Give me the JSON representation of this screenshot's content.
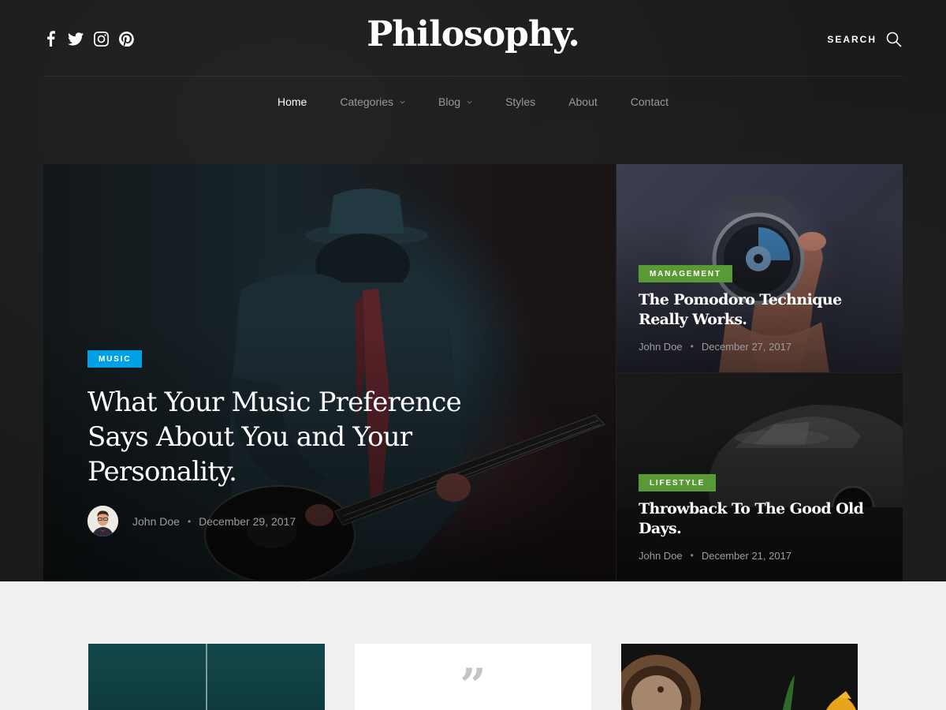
{
  "header": {
    "logo": "Philosophy.",
    "search_label": "SEARCH",
    "social": [
      "facebook-icon",
      "twitter-icon",
      "instagram-icon",
      "pinterest-icon"
    ]
  },
  "nav": {
    "items": [
      {
        "label": "Home",
        "active": true
      },
      {
        "label": "Categories",
        "dropdown": true
      },
      {
        "label": "Blog",
        "dropdown": true
      },
      {
        "label": "Styles"
      },
      {
        "label": "About"
      },
      {
        "label": "Contact"
      }
    ]
  },
  "featured": {
    "main": {
      "category": "MUSIC",
      "title": "What Your Music Preference Says About You and Your Personality.",
      "author": "John Doe",
      "date": "December 29, 2017",
      "badge_color": "#00a0e6"
    },
    "side": [
      {
        "category": "MANAGEMENT",
        "title": "The Pomodoro Technique Really Works.",
        "author": "John Doe",
        "date": "December 27, 2017",
        "badge_color": "#5a9a36"
      },
      {
        "category": "LIFESTYLE",
        "title": "Throwback To The Good Old Days.",
        "author": "John Doe",
        "date": "December 21, 2017",
        "badge_color": "#5a9a36"
      }
    ]
  },
  "cards": {
    "quote_glyph": "”"
  },
  "colors": {
    "dark_bg": "#1b1b1b",
    "light_bg": "#f0f0f0",
    "nav_inactive": "#9a9a9a"
  }
}
